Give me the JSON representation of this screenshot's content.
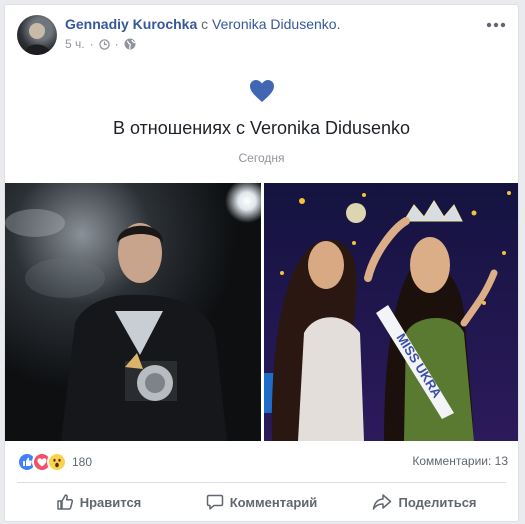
{
  "post": {
    "author": "Gennadiy Kurochka",
    "with_word": "с",
    "partner": "Veronika Didusenko.",
    "time": "5 ч.",
    "privacy_icon": "globe-icon"
  },
  "life_event": {
    "icon": "heart-icon",
    "title": "В отношениях с Veronika Didusenko",
    "date": "Сегодня"
  },
  "reactions": {
    "icons": [
      "like-icon",
      "love-icon",
      "wow-icon"
    ],
    "count": "180",
    "comments": "Комментарии: 13"
  },
  "actions": {
    "like": "Нравится",
    "comment": "Комментарий",
    "share": "Поделиться"
  },
  "photos": {
    "right_sash_text": "MISS UKRA"
  },
  "colors": {
    "link": "#365899",
    "heart": "#4267b2",
    "muted": "#90949c",
    "action": "#606770"
  }
}
